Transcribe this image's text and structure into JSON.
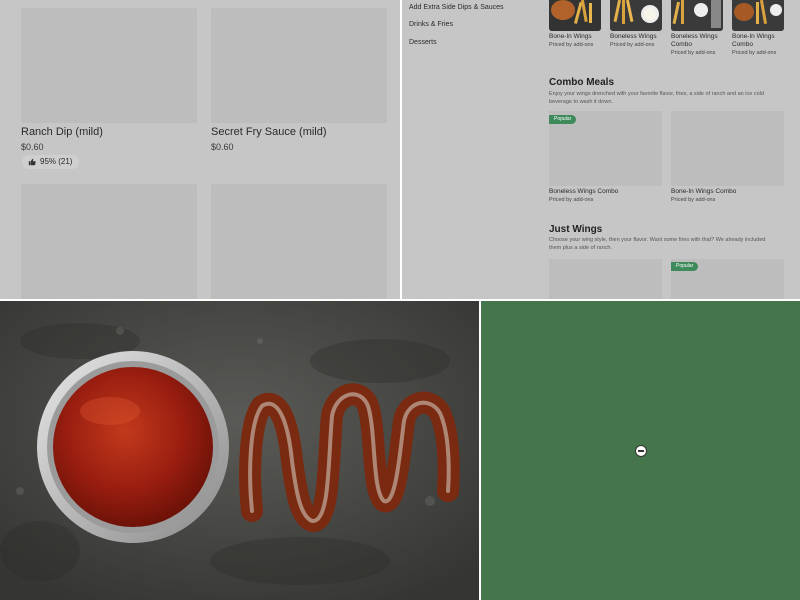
{
  "top_left": {
    "items": [
      {
        "name": "Ranch Dip (mild)",
        "price": "$0.60",
        "rating": "95% (21)"
      },
      {
        "name": "Secret Fry Sauce (mild)",
        "price": "$0.60"
      }
    ]
  },
  "top_right": {
    "nav": [
      "Add Extra Side Dips & Sauces",
      "Drinks & Fries",
      "Desserts"
    ],
    "featured": [
      {
        "name": "Bone-In Wings",
        "sub": "Priced by add-ons"
      },
      {
        "name": "Boneless Wings",
        "sub": "Priced by add-ons"
      },
      {
        "name": "Boneless Wings Combo",
        "sub": "Priced by add-ons"
      },
      {
        "name": "Bone-In Wings Combo",
        "sub": "Priced by add-ons"
      }
    ],
    "combo": {
      "title": "Combo Meals",
      "desc": "Enjoy your wings drenched with your favorite flavor, fries, a side of ranch and an ice cold beverage to wash it down.",
      "items": [
        {
          "name": "Boneless Wings Combo",
          "sub": "Priced by add-ons",
          "badge": "Popular"
        },
        {
          "name": "Bone-In Wings Combo",
          "sub": "Priced by add-ons"
        }
      ]
    },
    "just_wings": {
      "title": "Just Wings",
      "desc": "Choose your wing style, then your flavor. Want some fries with that? We already included them plus a side of ranch.",
      "badge": "Popular"
    }
  },
  "bottom_left": {
    "image": "sauce-cup-and-drizzle-photo",
    "colors": {
      "background": "#4a4a48",
      "sauce": "#9a1e10",
      "cup": "#c9c9c9"
    }
  },
  "bottom_right": {
    "background_color": "#45754a",
    "icon": "minus-circle-icon"
  }
}
